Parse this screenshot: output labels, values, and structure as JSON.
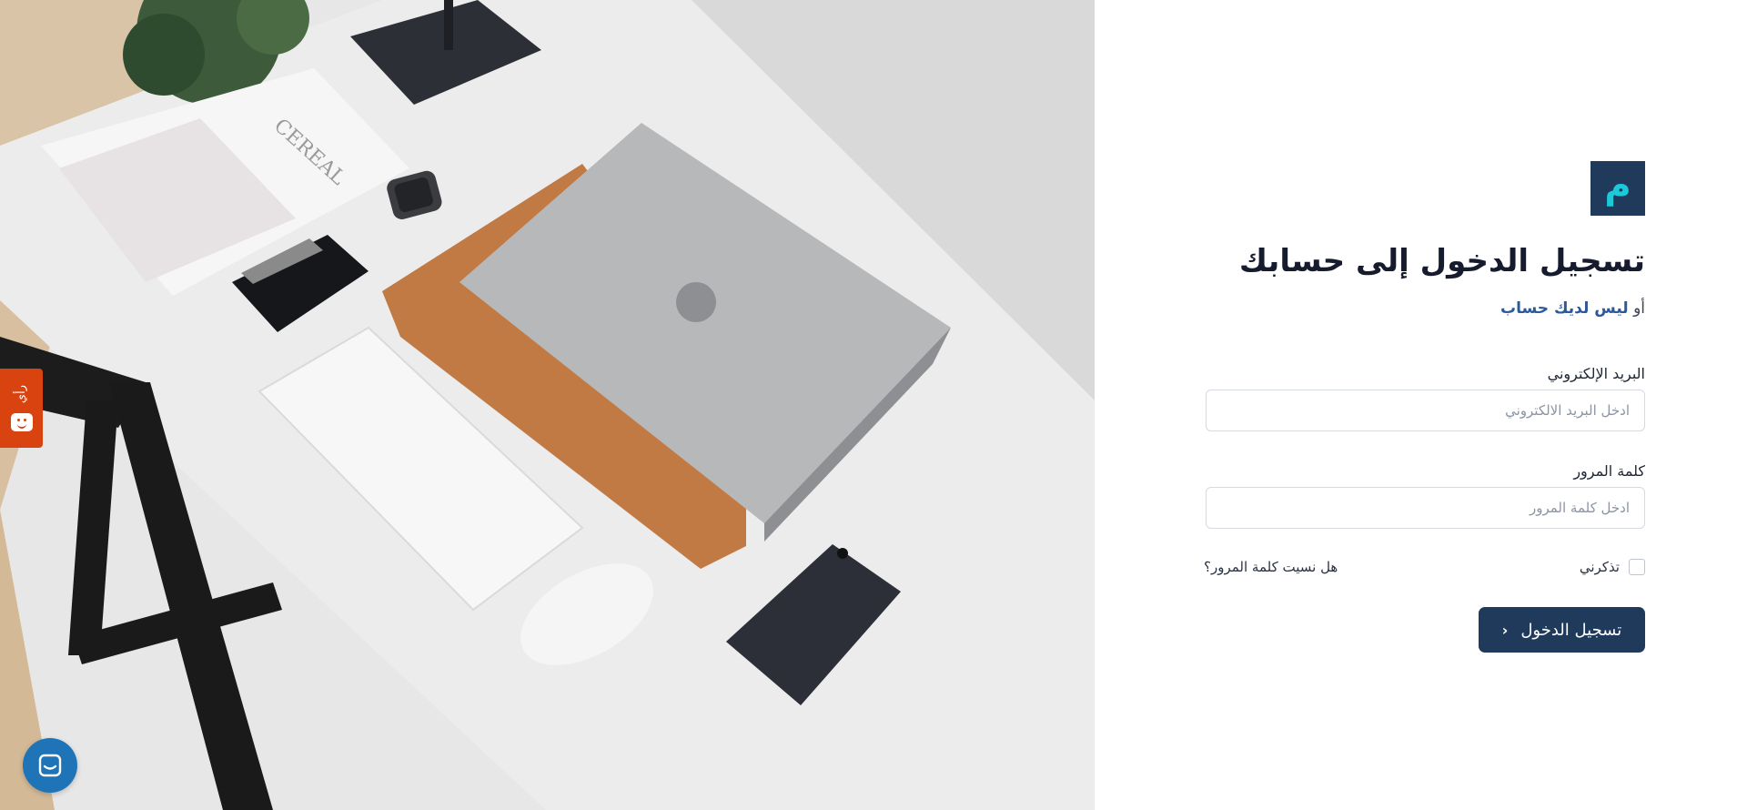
{
  "feedback": {
    "label": "رأي"
  },
  "logo": {
    "glyph": "م",
    "bg_color": "#1f3a5a",
    "glyph_color": "#1cc9d8"
  },
  "form": {
    "title": "تسجيل الدخول إلى حسابك",
    "subtitle_prefix": "أو",
    "signup_link": "ليس لديك حساب",
    "email": {
      "label": "البريد الإلكتروني",
      "placeholder": "ادخل البريد الالكتروني",
      "value": ""
    },
    "password": {
      "label": "كلمة المرور",
      "placeholder": "ادخل كلمة المرور",
      "value": ""
    },
    "remember_label": "تذكرني",
    "remember_checked": false,
    "forgot_link": "هل نسيت كلمة المرور؟",
    "submit_label": "تسجيل الدخول",
    "submit_icon": "chevron-left-icon"
  },
  "colors": {
    "primary": "#1f3a5a",
    "feedback_tab": "#d8430f",
    "chat": "#1f73b7",
    "link": "#2b5a9a"
  }
}
